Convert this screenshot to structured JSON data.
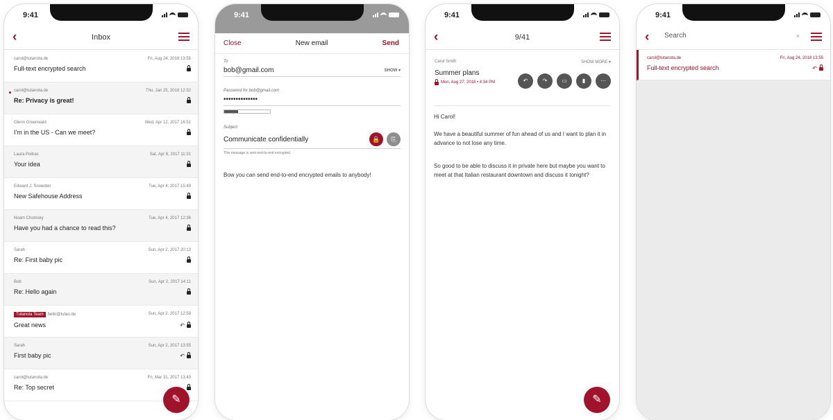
{
  "colors": {
    "accent": "#a0132b",
    "gray_band": "#9a9a9a"
  },
  "status_time": "9:41",
  "inbox": {
    "title": "Inbox",
    "back_icon": "chevron-left-icon",
    "menu_icon": "hamburger-icon",
    "items": [
      {
        "sender": "carol@tutanota.de",
        "date": "Fri, Aug 24, 2018 13:55",
        "subject": "Full-text encrypted search"
      },
      {
        "sender": "carol@tutanota.de",
        "date": "Thu, Jan 25, 2018 12:32",
        "subject": "Re: Privacy is great!"
      },
      {
        "sender": "Glenn Greenwald",
        "date": "Wed, Apr 12, 2017 16:51",
        "subject": "I'm in the US - Can we meet?"
      },
      {
        "sender": "Laura Poitras",
        "date": "Sat, Apr 8, 2017 11:31",
        "subject": "Your idea"
      },
      {
        "sender": "Edward J. Snowden",
        "date": "Tue, Apr 4, 2017 15:49",
        "subject": "New Safehouse Address"
      },
      {
        "sender": "Noam Chomsky",
        "date": "Tue, Apr 4, 2017 12:36",
        "subject": "Have you had a chance to read this?"
      },
      {
        "sender": "Sarah",
        "date": "Sun, Apr 2, 2017 20:13",
        "subject": "Re: First baby pic"
      },
      {
        "sender": "Bob",
        "date": "Sun, Apr 2, 2017 14:11",
        "subject": "Re: Hello again"
      },
      {
        "tag": "Tutanota Team",
        "sender": "hello@tutao.de",
        "date": "Sun, Apr 2, 2017 12:59",
        "subject": "Great news"
      },
      {
        "sender": "Sarah",
        "date": "Sun, Apr 2, 2017 13:55",
        "subject": "First baby pic"
      },
      {
        "sender": "carol@tutanota.de",
        "date": "Fri, Mar 31, 2017 13:43",
        "subject": "Re: Top secret"
      }
    ]
  },
  "compose": {
    "close": "Close",
    "title": "New email",
    "send": "Send",
    "to_label": "To",
    "to_value": "bob@gmail.com",
    "show": "SHOW ▾",
    "password_label": "Password for bob@gmail.com",
    "password_value": "••••••••••••••",
    "strength": 0.3,
    "subject_label": "Subject",
    "subject_value": "Communicate confidentially",
    "note": "This message is sent end-to-end encrypted.",
    "body": "Bow you can send end-to-end encrypted emails to anybody!"
  },
  "reader": {
    "title": "9/41",
    "sender": "Carol Smith",
    "show_more": "SHOW MORE ▾",
    "subject": "Summer plans",
    "date": "Mon, Aug 27, 2018 • 4:34 PM",
    "greeting": "Hi Carol!",
    "para1": "We have a beautiful summer of fun ahead of us and I want to plan it in advance to not lose any time.",
    "para2": "So good to be able to discuss it in private here but maybe you want to meet at that Italian restaurant downtown and discuss it tonight?"
  },
  "search": {
    "placeholder": "Search",
    "result_sender": "carol@tutanota.de",
    "result_date": "Fri, Aug 24, 2018 13:55",
    "result_subject": "Full-text encrypted search"
  }
}
